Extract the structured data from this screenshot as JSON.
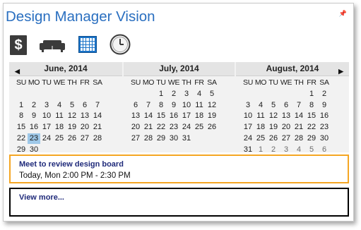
{
  "app": {
    "title": "Design Manager Vision"
  },
  "toolbar": {
    "dollar_label": "$",
    "icons": [
      "dollar-icon",
      "sofa-icon",
      "calendar-icon",
      "clock-icon"
    ]
  },
  "calendar": {
    "dow": [
      "SU",
      "MO",
      "TU",
      "WE",
      "TH",
      "FR",
      "SA"
    ],
    "months": [
      {
        "name": "June, 2014",
        "days": [
          [
            "",
            "",
            "1",
            "2",
            "3",
            "4",
            "5"
          ],
          [
            "6",
            "7",
            "8",
            "9",
            "10",
            "11",
            "12"
          ]
        ]
      },
      {
        "name": "July, 2014"
      },
      {
        "name": "August, 2014"
      }
    ],
    "selected_day": "23",
    "colors": {
      "today_highlight": "#9ec8e8",
      "header_bg": "#e4e4e4",
      "panel_bg": "#f2f2f2"
    }
  },
  "event": {
    "title": "Meet to review design board",
    "time": "Today, Mon 2:00 PM - 2:30 PM",
    "border_color": "#f5a623"
  },
  "more": {
    "label": "View more..."
  },
  "accent_color": "#2a6fc0"
}
